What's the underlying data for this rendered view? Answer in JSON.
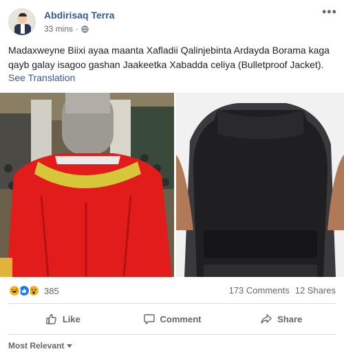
{
  "post": {
    "author": "Abdirisaq Terra",
    "time": "33 mins",
    "separator": "·",
    "privacy_icon": "globe-icon",
    "more_icon": "more-options-icon",
    "more_label": "•••",
    "text": "Madaxweyne Biixi ayaa maanta Xafladii Qalinjebinta Ardayda Borama kaga qayb galay isagoo gashan Jaakeetka Xabadda celiya (Bulletproof Jacket).",
    "see_translation": "See Translation"
  },
  "photos": [
    {
      "name": "photo-graduation-robe",
      "description_icon": "photo"
    },
    {
      "name": "photo-bulletproof-vest",
      "description_icon": "photo"
    }
  ],
  "stats": {
    "reaction_icons": [
      "haha-icon",
      "like-icon",
      "wow-icon"
    ],
    "reaction_count": "385",
    "comments": "173 Comments",
    "shares": "12 Shares"
  },
  "actions": {
    "like": "Like",
    "comment": "Comment",
    "share": "Share"
  },
  "comments_sort": {
    "label": "Most Relevant"
  },
  "colors": {
    "link": "#385898",
    "secondary_text": "#606770",
    "like_blue": "#1877f2",
    "haha_yellow": "#f7b125",
    "divider": "#dadde1"
  }
}
